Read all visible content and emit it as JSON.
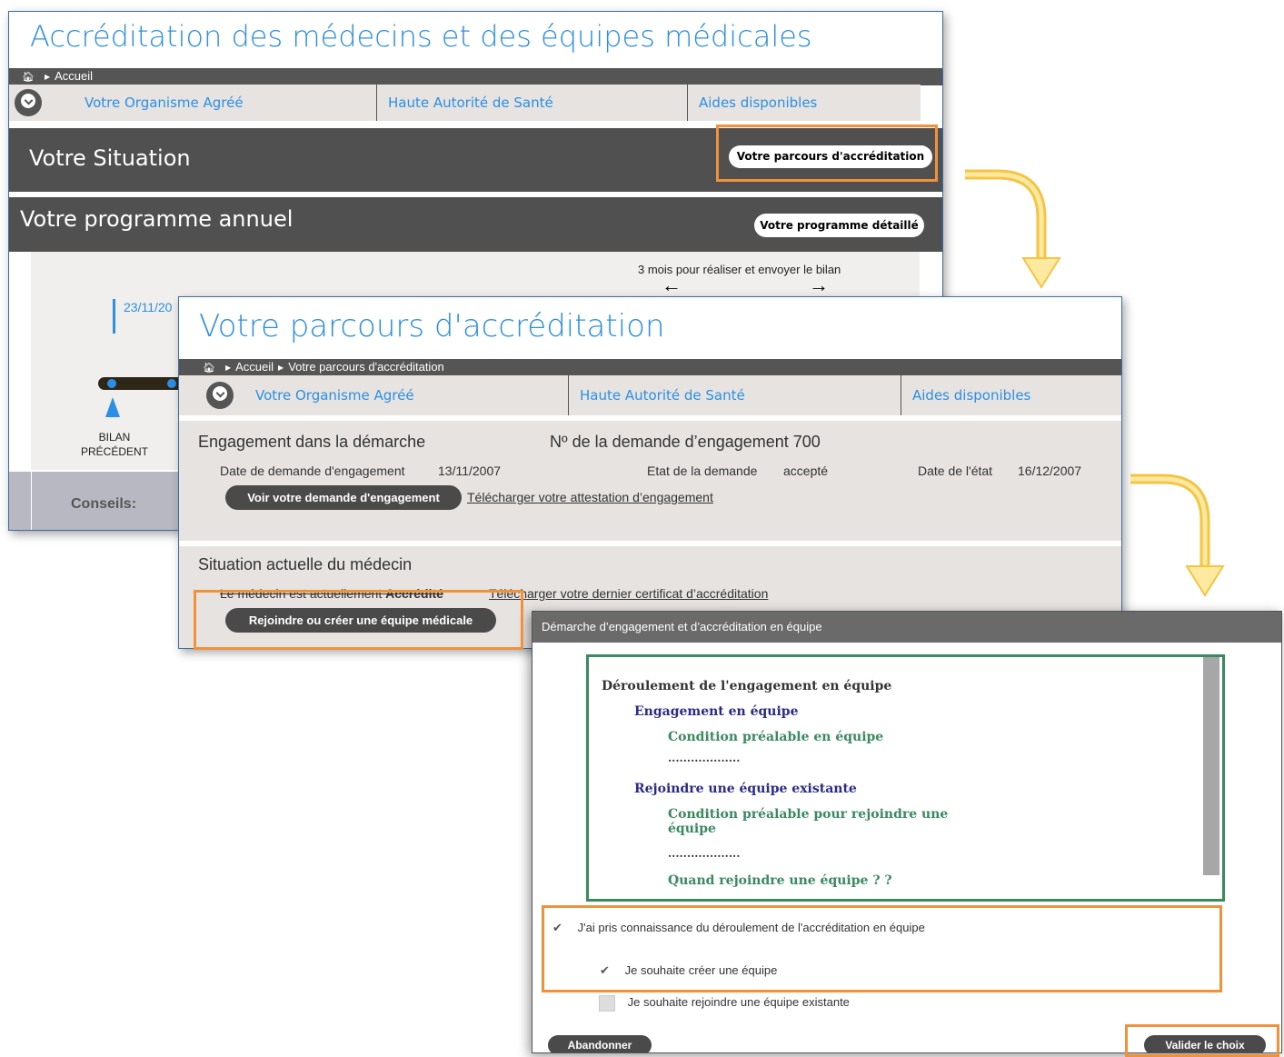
{
  "panel1": {
    "title": "Accréditation des médecins et des équipes médicales",
    "breadcrumb": [
      "Accueil"
    ],
    "nav": [
      "Votre Organisme Agréé",
      "Haute Autorité de Santé",
      "Aides disponibles"
    ],
    "situation_title": "Votre Situation",
    "situation_button": "Votre parcours d'accréditation",
    "programme_title": "Votre programme annuel",
    "programme_button": "Votre programme détaillé",
    "timeline_note": "3 mois pour réaliser et envoyer le bilan",
    "timeline_date": "23/11/20",
    "bilan_label_1": "BILAN",
    "bilan_label_2": "PRÉCÉDENT",
    "conseils": "Conseils:"
  },
  "panel2": {
    "title": "Votre parcours d'accréditation",
    "breadcrumb": [
      "Accueil",
      "Votre parcours d'accréditation"
    ],
    "nav": [
      "Votre Organisme Agréé",
      "Haute Autorité de Santé",
      "Aides disponibles"
    ],
    "engagement": {
      "heading": "Engagement dans la démarche",
      "request_number_label": "Nº de la demande d’engagement 700",
      "date_label": "Date de demande d'engagement",
      "date_value": "13/11/2007",
      "state_label": "Etat de la demande",
      "state_value": "accepté",
      "state_date_label": "Date de l'état",
      "state_date_value": "16/12/2007",
      "view_button": "Voir votre demande d'engagement",
      "download_link": "Télécharger votre attestation d’engagement"
    },
    "situation": {
      "heading": "Situation actuelle du médecin",
      "status_text": "Le médecin est actuellement",
      "status_value": "Accrédité",
      "certificate_link": "Télécharger votre dernier certificat d’accréditation",
      "team_button": "Rejoindre ou créer une équipe médicale"
    }
  },
  "dialog": {
    "title": "Démarche d’engagement et d’accréditation en équipe",
    "content": {
      "heading": "Déroulement de l'engagement en équipe",
      "section1": "Engagement en équipe",
      "section1_item": "Condition préalable en équipe",
      "dots1": "...................",
      "section2": "Rejoindre une équipe existante",
      "section2_item": "Condition préalable pour rejoindre une équipe",
      "dots2": "...................",
      "section2_item2": "Quand rejoindre une équipe ? ?"
    },
    "checkbox_ack": "J'ai pris connaissance du déroulement de l'accréditation en équipe",
    "checkbox_create": "Je souhaite créer une équipe",
    "checkbox_join": "Je souhaite rejoindre une équipe existante",
    "cancel_button": "Abandonner",
    "validate_button": "Valider le choix",
    "ack_checked": true,
    "create_checked": true,
    "join_checked": false
  },
  "colors": {
    "title_blue": "#2b8fe6",
    "highlight_orange": "#f0913b",
    "arrow_yellow": "#f6c445",
    "dark_bar": "#505050",
    "light_bg": "#e6e3e1",
    "dialog_border_green": "#3a8a5f",
    "dialog_navy": "#2a2a8c",
    "dialog_green": "#3a8a5f"
  }
}
